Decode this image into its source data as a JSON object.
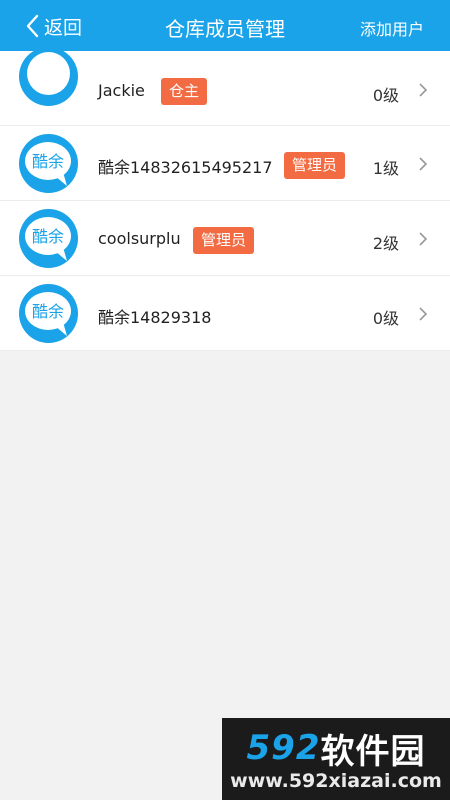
{
  "header": {
    "back_label": "返回",
    "title": "仓库成员管理",
    "add_user_label": "添加用户"
  },
  "members": [
    {
      "name": "Jackie",
      "role": "仓主",
      "level": "0级",
      "avatar": "blank"
    },
    {
      "name": "酷余14832615495217",
      "role": "管理员",
      "level": "1级",
      "avatar": "酷余"
    },
    {
      "name": "coolsurplu",
      "role": "管理员",
      "level": "2级",
      "avatar": "酷余"
    },
    {
      "name": "酷余14829318",
      "role": "",
      "level": "0级",
      "avatar": "酷余"
    }
  ],
  "watermark": {
    "brand_number": "592",
    "brand_text": "软件园",
    "url": "www.592xiazai.com"
  },
  "colors": {
    "header_bg": "#1aa3e8",
    "badge_bg": "#f26b43",
    "page_bg": "#f2f2f2"
  }
}
